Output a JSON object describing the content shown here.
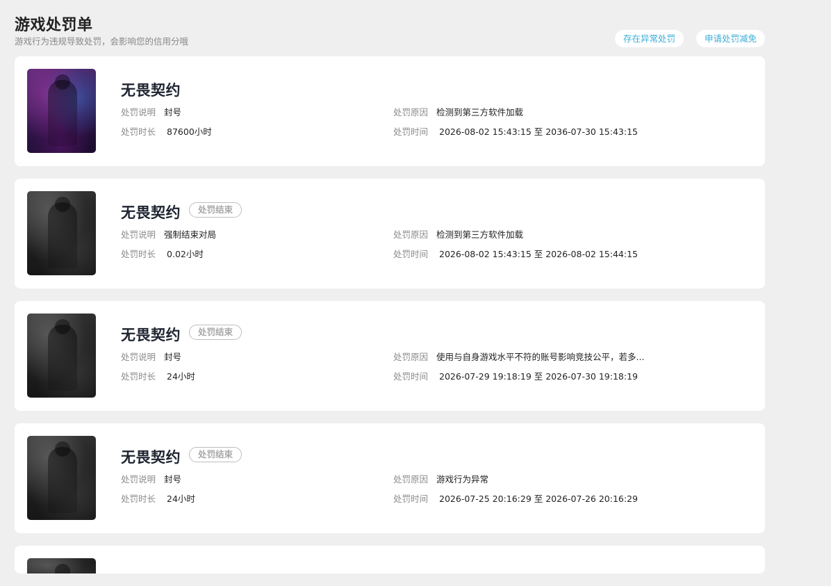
{
  "header": {
    "title": "游戏处罚单",
    "subtitle": "游戏行为违规导致处罚，会影响您的信用分哦",
    "exception_button": "存在异常处罚",
    "appeal_button": "申请处罚减免"
  },
  "labels": {
    "description": "处罚说明",
    "reason": "处罚原因",
    "duration": "处罚时长",
    "time": "处罚时间"
  },
  "colors": {
    "accent": "#3aaed8",
    "badge": "#a9a9a9"
  },
  "cards": [
    {
      "game": "无畏契约",
      "badge": "",
      "description": "封号",
      "reason": "检测到第三方软件加载",
      "duration": "87600小时",
      "time": "2026-08-02 15:43:15 至 2036-07-30 15:43:15"
    },
    {
      "game": "无畏契约",
      "badge": "处罚结束",
      "description": "强制结束对局",
      "reason": "检测到第三方软件加载",
      "duration": "0.02小时",
      "time": "2026-08-02 15:43:15 至 2026-08-02 15:44:15"
    },
    {
      "game": "无畏契约",
      "badge": "处罚结束",
      "description": "封号",
      "reason": "使用与自身游戏水平不符的账号影响竞技公平，若多...",
      "duration": "24小时",
      "time": "2026-07-29 19:18:19 至 2026-07-30 19:18:19"
    },
    {
      "game": "无畏契约",
      "badge": "处罚结束",
      "description": "封号",
      "reason": "游戏行为异常",
      "duration": "24小时",
      "time": "2026-07-25 20:16:29 至 2026-07-26 20:16:29"
    }
  ]
}
